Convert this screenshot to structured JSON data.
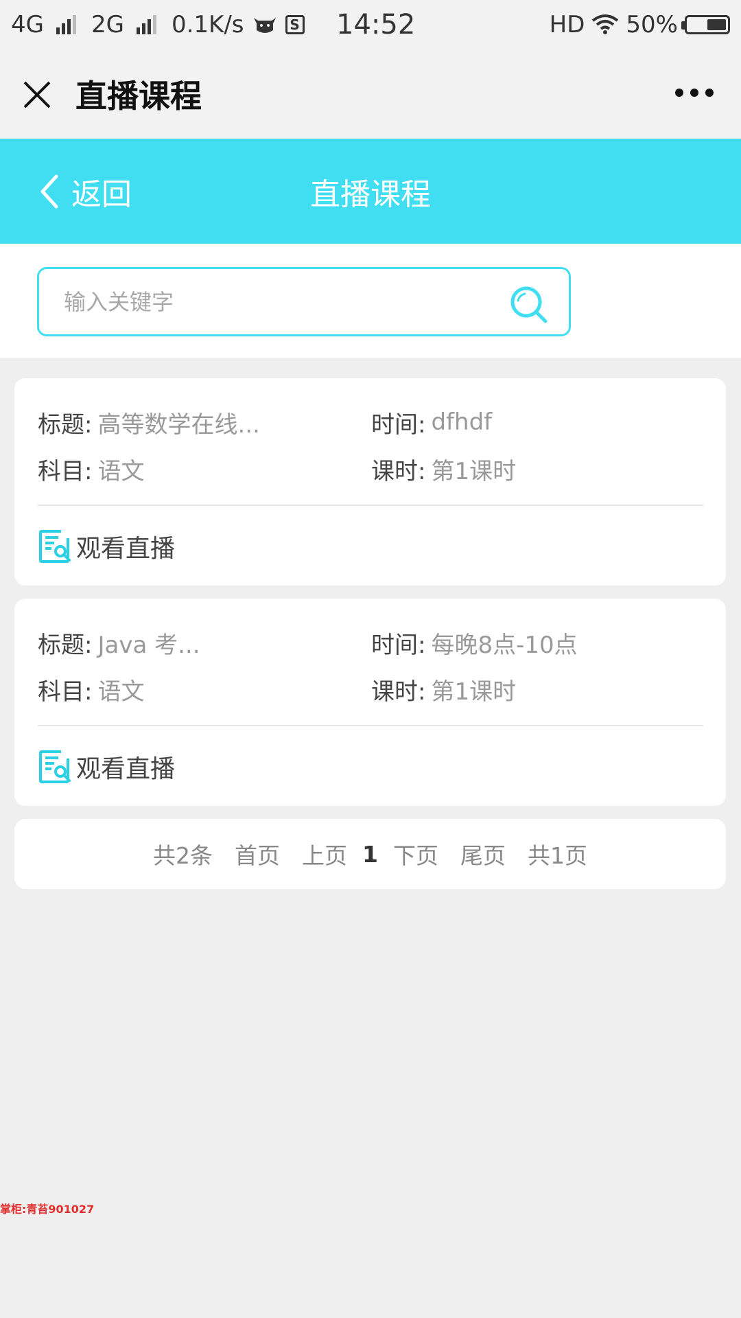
{
  "status_bar": {
    "net1": "4G",
    "net2": "2G",
    "speed": "0.1K/s",
    "time": "14:52",
    "hd": "HD",
    "battery": "50%",
    "battery_level": 0.5
  },
  "wx_bar": {
    "title": "直播课程"
  },
  "header": {
    "back_label": "返回",
    "title": "直播课程",
    "accent_color": "#41def2"
  },
  "search": {
    "placeholder": "输入关键字",
    "value": ""
  },
  "labels": {
    "title": "标题:",
    "time": "时间:",
    "subject": "科目:",
    "period": "课时:",
    "watch": "观看直播"
  },
  "courses": [
    {
      "title": "高等数学在线...",
      "time": "dfhdf",
      "subject": "语文",
      "period": "第1课时"
    },
    {
      "title": "Java 考...",
      "time": "每晚8点-10点",
      "subject": "语文",
      "period": "第1课时"
    }
  ],
  "pager": {
    "total": "共2条",
    "first": "首页",
    "prev": "上页",
    "current": "1",
    "next": "下页",
    "last": "尾页",
    "pages": "共1页"
  },
  "watermark": "掌柜:青苔901027"
}
